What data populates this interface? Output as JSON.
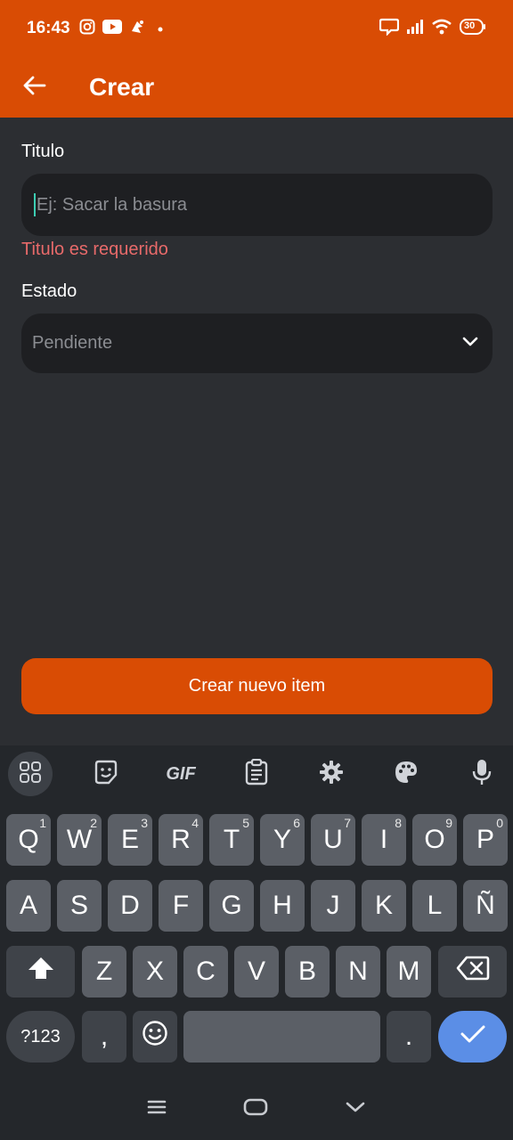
{
  "status_bar": {
    "time": "16:43",
    "left_icons": [
      "instagram-icon",
      "youtube-icon",
      "app-notification-icon",
      "dot-icon"
    ],
    "right_icons": [
      "chat-icon",
      "signal-icon",
      "wifi-icon",
      "battery-icon"
    ],
    "battery": "30"
  },
  "app_bar": {
    "title": "Crear"
  },
  "form": {
    "title_label": "Titulo",
    "title_placeholder": "Ej: Sacar la basura",
    "title_error": "Titulo es requerido",
    "status_label": "Estado",
    "status_value": "Pendiente",
    "submit_label": "Crear nuevo item"
  },
  "keyboard": {
    "toolbar": [
      "apps-icon",
      "sticker-icon",
      "gif-icon",
      "clipboard-icon",
      "settings-icon",
      "theme-icon",
      "mic-icon"
    ],
    "gif_label": "GIF",
    "row1": [
      {
        "k": "Q",
        "s": "1"
      },
      {
        "k": "W",
        "s": "2"
      },
      {
        "k": "E",
        "s": "3"
      },
      {
        "k": "R",
        "s": "4"
      },
      {
        "k": "T",
        "s": "5"
      },
      {
        "k": "Y",
        "s": "6"
      },
      {
        "k": "U",
        "s": "7"
      },
      {
        "k": "I",
        "s": "8"
      },
      {
        "k": "O",
        "s": "9"
      },
      {
        "k": "P",
        "s": "0"
      }
    ],
    "row2": [
      "A",
      "S",
      "D",
      "F",
      "G",
      "H",
      "J",
      "K",
      "L",
      "Ñ"
    ],
    "row3": [
      "Z",
      "X",
      "C",
      "V",
      "B",
      "N",
      "M"
    ],
    "symbols_label": "?123",
    "comma": ",",
    "period": "."
  },
  "colors": {
    "accent": "#d94c04",
    "background": "#2c2e32",
    "field": "#1e1f22",
    "error": "#e86a6a",
    "enter_key": "#5b8ee6"
  }
}
